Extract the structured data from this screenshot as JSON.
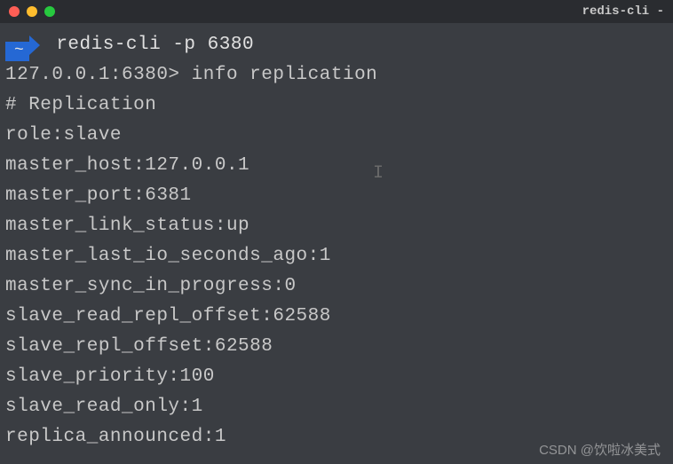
{
  "titlebar": {
    "title": "redis-cli -"
  },
  "prompt": {
    "symbol": "~",
    "command": "redis-cli -p 6380"
  },
  "repl": {
    "host_prompt": "127.0.0.1:6380>",
    "input_command": "info replication"
  },
  "output": {
    "header": "# Replication",
    "lines": [
      "role:slave",
      "master_host:127.0.0.1",
      "master_port:6381",
      "master_link_status:up",
      "master_last_io_seconds_ago:1",
      "master_sync_in_progress:0",
      "slave_read_repl_offset:62588",
      "slave_repl_offset:62588",
      "slave_priority:100",
      "slave_read_only:1",
      "replica_announced:1"
    ]
  },
  "watermark": "CSDN @饮啦冰美式"
}
